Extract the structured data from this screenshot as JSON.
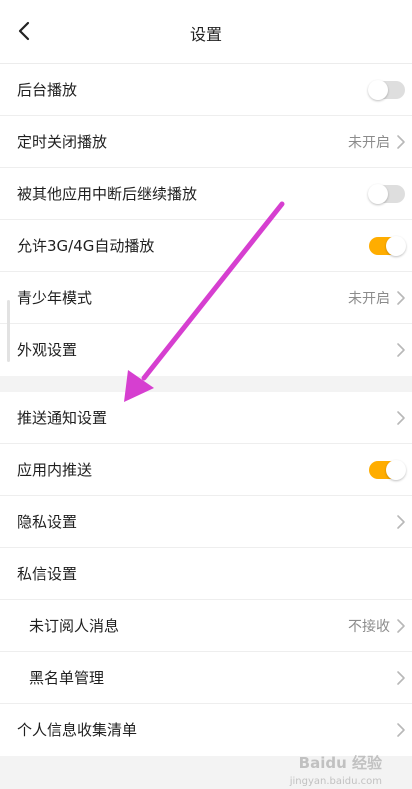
{
  "header": {
    "title": "设置",
    "back_icon": "chevron-left-icon"
  },
  "section1": [
    {
      "label": "后台播放",
      "toggle": "off"
    },
    {
      "label": "定时关闭播放",
      "value": "未开启",
      "chevron": true
    },
    {
      "label": "被其他应用中断后继续播放",
      "toggle": "off"
    },
    {
      "label": "允许3G/4G自动播放",
      "toggle": "on"
    },
    {
      "label": "青少年模式",
      "value": "未开启",
      "chevron": true
    },
    {
      "label": "外观设置",
      "chevron": true
    }
  ],
  "section2": [
    {
      "label": "推送通知设置",
      "chevron": true
    },
    {
      "label": "应用内推送",
      "toggle": "on"
    },
    {
      "label": "隐私设置",
      "chevron": true
    },
    {
      "label": "私信设置"
    },
    {
      "label": "未订阅人消息",
      "value": "不接收",
      "chevron": true
    },
    {
      "label": "黑名单管理",
      "chevron": true
    },
    {
      "label": "个人信息收集清单",
      "chevron": true
    }
  ],
  "colors": {
    "toggle_on": "#ffad00",
    "toggle_off": "#dedede",
    "annotation_arrow": "#d63fd0"
  },
  "watermark": {
    "line1": "Baidu 经验",
    "line2": "jingyan.baidu.com"
  }
}
